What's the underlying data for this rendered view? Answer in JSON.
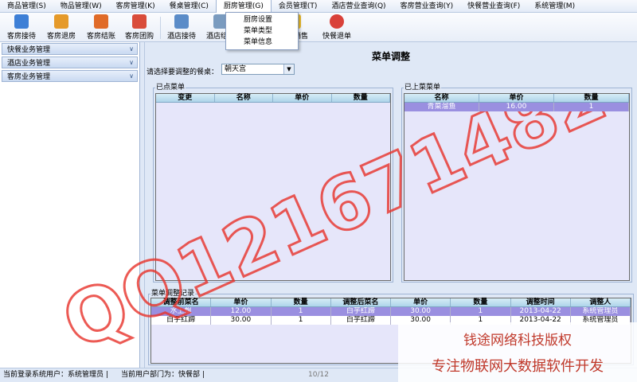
{
  "menubar": {
    "items": [
      {
        "label": "商品管理(S)"
      },
      {
        "label": "物品管理(W)"
      },
      {
        "label": "客房管理(K)"
      },
      {
        "label": "餐桌管理(C)"
      },
      {
        "label": "厨房管理(G)"
      },
      {
        "label": "会员管理(T)"
      },
      {
        "label": "酒店营业查询(Q)"
      },
      {
        "label": "客房营业查询(Y)"
      },
      {
        "label": "快餐营业查询(F)"
      },
      {
        "label": "系统管理(M)"
      }
    ]
  },
  "dropdown": {
    "items": [
      {
        "label": "厨房设置"
      },
      {
        "label": "菜单类型"
      },
      {
        "label": "菜单信息"
      }
    ]
  },
  "toolbar": {
    "buttons": [
      {
        "label": "客房接待",
        "icon": "reception-icon",
        "color": "#3d7fd6"
      },
      {
        "label": "客房退房",
        "icon": "checkout-icon",
        "color": "#e59a2a"
      },
      {
        "label": "客房结账",
        "icon": "billing-icon",
        "color": "#e06b28"
      },
      {
        "label": "客房团购",
        "icon": "groupbuy-icon",
        "color": "#d94c3a"
      },
      {
        "label": "酒店接待",
        "icon": "hotel-reception-icon",
        "color": "#5b8cc8"
      },
      {
        "label": "酒店结账",
        "icon": "hotel-billing-icon",
        "color": "#7a9bbf"
      },
      {
        "label": "快餐销售",
        "icon": "star-icon",
        "color": "#f2c230"
      },
      {
        "label": "快餐退单",
        "icon": "gear-icon",
        "color": "#d9413a"
      }
    ]
  },
  "sidebar": {
    "groups": [
      {
        "label": "快餐业务管理"
      },
      {
        "label": "酒店业务管理"
      },
      {
        "label": "客房业务管理"
      }
    ]
  },
  "main": {
    "title": "菜单调整",
    "select_label": "请选择要调整的餐桌：",
    "select_value": "朝天宫",
    "ordered": {
      "title": "已点菜单",
      "columns": [
        "变更",
        "名称",
        "单价",
        "数量"
      ]
    },
    "served": {
      "title": "已上菜菜单",
      "columns": [
        "名称",
        "单价",
        "数量"
      ],
      "rows": [
        [
          "青菜溜鱼",
          "16.00",
          "1"
        ]
      ]
    },
    "records": {
      "title": "菜单调整记录",
      "columns": [
        "调整前菜名",
        "单价",
        "数量",
        "调整后菜名",
        "单价",
        "数量",
        "调整时间",
        "调整人"
      ],
      "rows": [
        [
          "水上飘",
          "12.00",
          "1",
          "白芋红蹄",
          "30.00",
          "1",
          "2013-04-22",
          "系统管理员"
        ],
        [
          "白芋红蹄",
          "30.00",
          "1",
          "白芋红蹄",
          "30.00",
          "1",
          "2013-04-22",
          "系统管理员"
        ]
      ]
    }
  },
  "statusbar": {
    "user": "当前登录系统用户：系统管理员 |",
    "dept": "当前用户部门为：快餐部 |",
    "page": "10/12"
  },
  "watermark": {
    "qq": "QQ1216714825",
    "line1": "钱途网络科技版权",
    "line2": "专注物联网大数据软件开发",
    "color": "#e8322a"
  }
}
